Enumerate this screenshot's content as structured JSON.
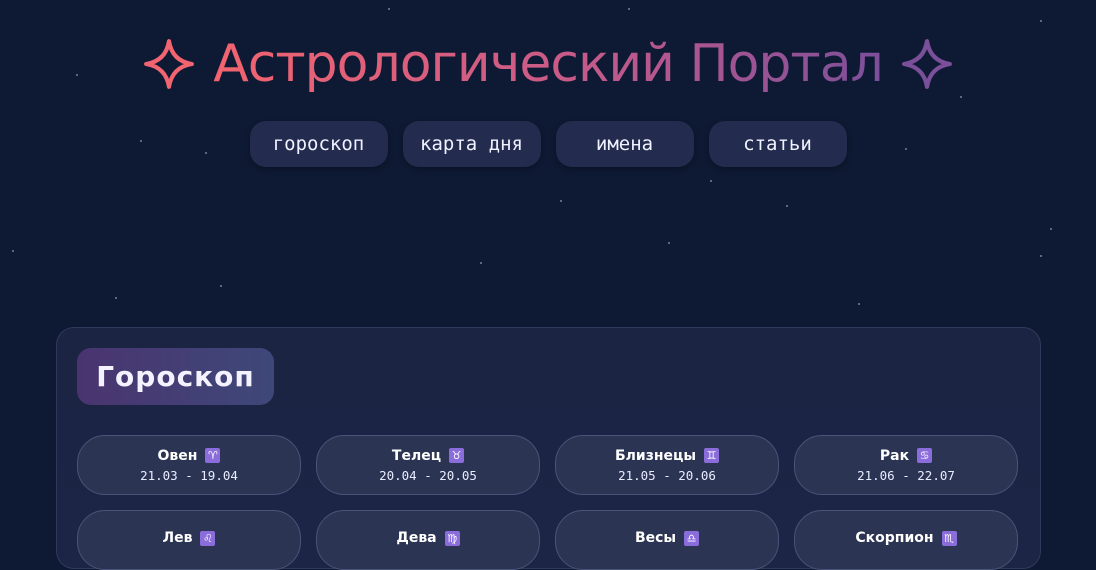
{
  "header": {
    "title": "Астрологический Портал",
    "left_icon": "sparkle-icon",
    "right_icon": "sparkle-icon"
  },
  "nav": {
    "items": [
      {
        "label": "гороскоп"
      },
      {
        "label": "карта дня"
      },
      {
        "label": "имена"
      },
      {
        "label": "статьи"
      }
    ]
  },
  "horoscope": {
    "title": "Гороскоп",
    "signs": [
      {
        "name": "Овен",
        "icon": "♈",
        "dates": "21.03 - 19.04"
      },
      {
        "name": "Телец",
        "icon": "♉",
        "dates": "20.04 - 20.05"
      },
      {
        "name": "Близнецы",
        "icon": "♊",
        "dates": "21.05 - 20.06"
      },
      {
        "name": "Рак",
        "icon": "♋",
        "dates": "21.06 - 22.07"
      },
      {
        "name": "Лев",
        "icon": "♌",
        "dates": ""
      },
      {
        "name": "Дева",
        "icon": "♍",
        "dates": ""
      },
      {
        "name": "Весы",
        "icon": "♎",
        "dates": ""
      },
      {
        "name": "Скорпион",
        "icon": "♏",
        "dates": ""
      }
    ]
  },
  "colors": {
    "background": "#0e1a33",
    "title_gradient_start": "#f2646f",
    "title_gradient_end": "#7c4f9b",
    "nav_button": "#232b4e",
    "card": "#2b3453",
    "zodiac_icon_bg": "#8a6cdb"
  }
}
